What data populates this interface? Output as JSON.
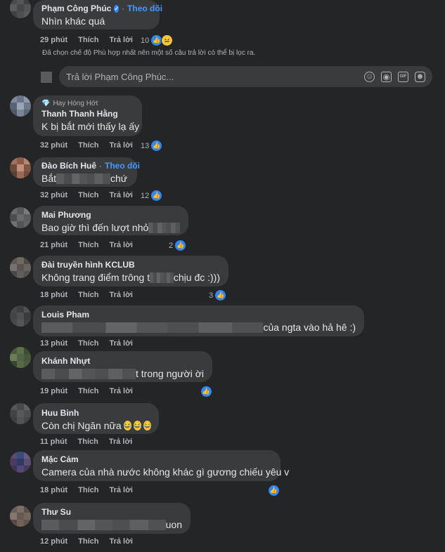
{
  "colors": {
    "background": "#242526",
    "bubble": "#3a3b3c",
    "accent": "#4599ff",
    "like": "#2d88ff"
  },
  "comments": [
    {
      "name": "Phạm Công Phúc",
      "verified": true,
      "follow": "Theo dõi",
      "text_before": "Nhìn khác quá",
      "text_after": "",
      "time": "29 phút",
      "like": "Thích",
      "reply": "Trả lời",
      "reactions": "10",
      "reaction_icons": [
        "like-icon",
        "haha-icon"
      ]
    },
    {
      "badge": "Hay Hóng Hớt",
      "name": "Thanh Thanh Hằng",
      "text_before": "K bị bắt mới thấy lạ ấy",
      "text_after": "",
      "time": "32 phút",
      "like": "Thích",
      "reply": "Trả lời",
      "reactions": "13",
      "reaction_icons": [
        "like-icon"
      ]
    },
    {
      "name": "Đào Bích Huê",
      "follow": "Theo dõi",
      "text_before": "Bắt",
      "text_after": "chứ",
      "time": "32 phút",
      "like": "Thích",
      "reply": "Trả lời",
      "reactions": "12",
      "reaction_icons": [
        "like-icon"
      ]
    },
    {
      "name": "Mai Phương",
      "text_before": "Bao giờ thì đến lượt nhỏ",
      "text_after": "",
      "time": "21 phút",
      "like": "Thích",
      "reply": "Trả lời",
      "reactions": "2",
      "reaction_icons": [
        "like-icon"
      ]
    },
    {
      "name": "Đài truyền hình KCLUB",
      "text_before": "Không trang điểm trông t",
      "text_after": "chịu đc :)))",
      "time": "18 phút",
      "like": "Thích",
      "reply": "Trả lời",
      "reactions": "3",
      "reaction_icons": [
        "like-icon"
      ]
    },
    {
      "name": "Louis Pham",
      "text_before": "",
      "text_after": "của ngta vào hả hê :)",
      "time": "13 phút",
      "like": "Thích",
      "reply": "Trả lời",
      "reactions": "",
      "reaction_icons": []
    },
    {
      "name": "Khánh Nhựt",
      "text_before": "",
      "text_after": "t trong người ời",
      "time": "19 phút",
      "like": "Thích",
      "reply": "Trả lời",
      "reactions": "",
      "reaction_icons": [
        "like-icon"
      ]
    },
    {
      "name": "Huu Binh",
      "text_before": "Còn chị Ngăn nữa",
      "text_after": "",
      "time": "11 phút",
      "like": "Thích",
      "reply": "Trả lời",
      "reactions": "",
      "reaction_icons": [],
      "emojis": [
        "haha-emoji",
        "haha-emoji",
        "haha-emoji"
      ]
    },
    {
      "name": "Mặc Cảm",
      "text_before": "Camera của nhà nước không khác gì gương chiếu yêu v",
      "text_after": "",
      "time": "18 phút",
      "like": "Thích",
      "reply": "Trả lời",
      "reactions": "",
      "reaction_icons": [
        "like-icon"
      ]
    },
    {
      "name": "Thư Su",
      "text_before": "",
      "text_after": "uon",
      "time": "12 phút",
      "like": "Thích",
      "reply": "Trả lời",
      "reactions": "",
      "reaction_icons": []
    }
  ],
  "filter_note": "Đã chọn chế độ Phù hợp nhất nên một số câu trả lời có thể bị lọc ra.",
  "reply_box": {
    "placeholder": "Trả lời Phạm Công Phúc...",
    "icons": [
      "smile-icon",
      "camera-icon",
      "gif-icon",
      "sticker-icon"
    ]
  }
}
